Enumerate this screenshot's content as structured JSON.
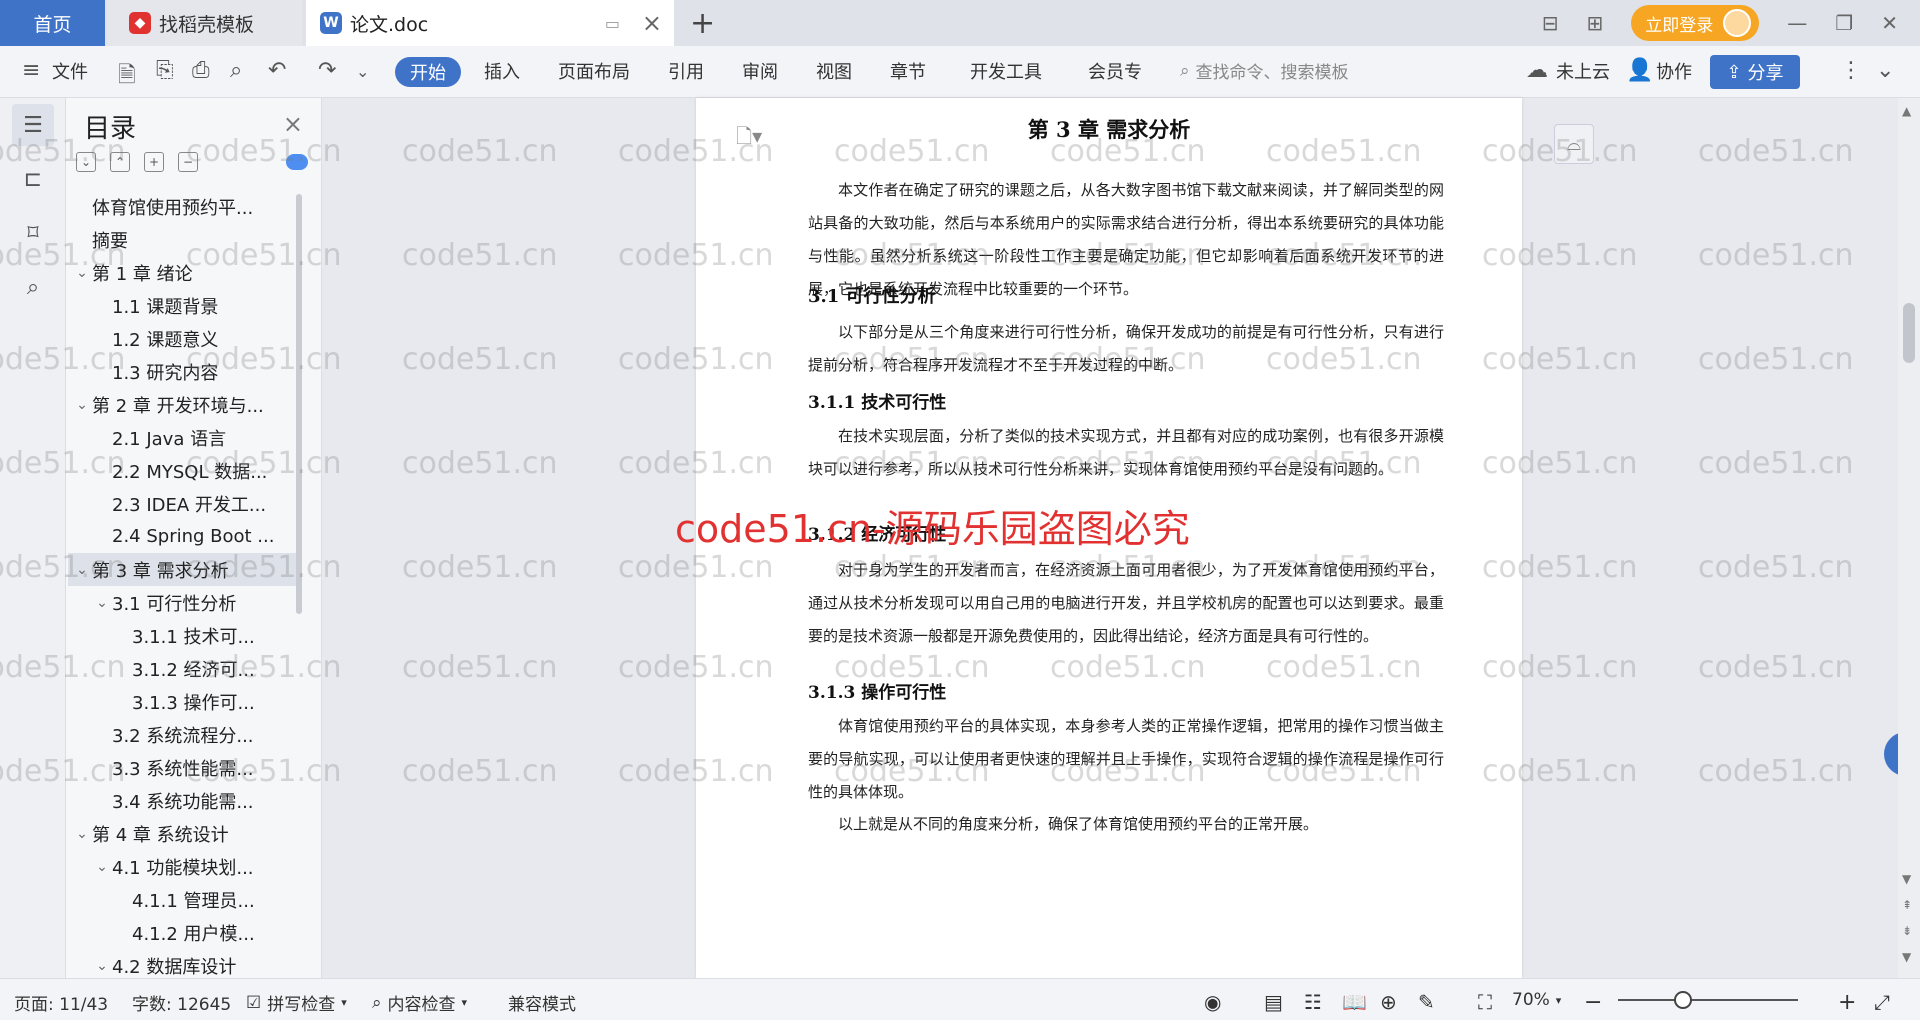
{
  "titlebar": {
    "tab_home": "首页",
    "tab_template": "找稻壳模板",
    "tab_doc": "论文.doc",
    "login": "立即登录"
  },
  "ribbon": {
    "file": "文件",
    "tabs": [
      "开始",
      "插入",
      "页面布局",
      "引用",
      "审阅",
      "视图",
      "章节",
      "开发工具",
      "会员专"
    ],
    "search_placeholder": "查找命令、搜索模板",
    "cloud": "未上云",
    "collab": "协作",
    "share": "分享"
  },
  "toc": {
    "title": "目录",
    "items": [
      {
        "label": "体育馆使用预约平...",
        "level": 0,
        "arrow": ""
      },
      {
        "label": "摘要",
        "level": 0,
        "arrow": ""
      },
      {
        "label": "第 1 章  绪论",
        "level": 0,
        "arrow": "⌄"
      },
      {
        "label": "1.1  课题背景",
        "level": 1,
        "arrow": ""
      },
      {
        "label": "1.2  课题意义",
        "level": 1,
        "arrow": ""
      },
      {
        "label": "1.3  研究内容",
        "level": 1,
        "arrow": ""
      },
      {
        "label": "第 2 章  开发环境与...",
        "level": 0,
        "arrow": "⌄"
      },
      {
        "label": "2.1 Java 语言",
        "level": 1,
        "arrow": ""
      },
      {
        "label": "2.2 MYSQL 数据...",
        "level": 1,
        "arrow": ""
      },
      {
        "label": "2.3 IDEA 开发工...",
        "level": 1,
        "arrow": ""
      },
      {
        "label": "2.4 Spring Boot ...",
        "level": 1,
        "arrow": ""
      },
      {
        "label": "第 3 章  需求分析",
        "level": 0,
        "arrow": "⌄",
        "selected": true
      },
      {
        "label": "3.1  可行性分析",
        "level": 1,
        "arrow": "⌄"
      },
      {
        "label": "3.1.1  技术可...",
        "level": 2,
        "arrow": ""
      },
      {
        "label": "3.1.2  经济可...",
        "level": 2,
        "arrow": ""
      },
      {
        "label": "3.1.3  操作可...",
        "level": 2,
        "arrow": ""
      },
      {
        "label": "3.2  系统流程分...",
        "level": 1,
        "arrow": ""
      },
      {
        "label": "3.3  系统性能需...",
        "level": 1,
        "arrow": ""
      },
      {
        "label": "3.4  系统功能需...",
        "level": 1,
        "arrow": ""
      },
      {
        "label": "第 4 章  系统设计",
        "level": 0,
        "arrow": "⌄"
      },
      {
        "label": "4.1  功能模块划...",
        "level": 1,
        "arrow": "⌄"
      },
      {
        "label": "4.1.1  管理员...",
        "level": 2,
        "arrow": ""
      },
      {
        "label": "4.1.2  用户模...",
        "level": 2,
        "arrow": ""
      },
      {
        "label": "4.2  数据库设计",
        "level": 1,
        "arrow": "⌄"
      }
    ]
  },
  "document": {
    "chapter_title": "第 3 章  需求分析",
    "intro": "本文作者在确定了研究的课题之后，从各大数字图书馆下载文献来阅读，并了解同类型的网站具备的大致功能，然后与本系统用户的实际需求结合进行分析，得出本系统要研究的具体功能与性能。虽然分析系统这一阶段性工作主要是确定功能，但它却影响着后面系统开发环节的进展，它也是系统开发流程中比较重要的一个环节。",
    "h_31": "3.1  可行性分析",
    "p_31": "以下部分是从三个角度来进行可行性分析，确保开发成功的前提是有可行性分析，只有进行提前分析，符合程序开发流程才不至于开发过程的中断。",
    "h_311": "3.1.1  技术可行性",
    "p_311": "在技术实现层面，分析了类似的技术实现方式，并且都有对应的成功案例，也有很多开源模块可以进行参考，所以从技术可行性分析来讲，实现体育馆使用预约平台是没有问题的。",
    "h_312": "3.1.2  经济可行性",
    "p_312": "对于身为学生的开发者而言，在经济资源上面可用者很少，为了开发体育馆使用预约平台，通过从技术分析发现可以用自己用的电脑进行开发，并且学校机房的配置也可以达到要求。最重要的是技术资源一般都是开源免费使用的，因此得出结论，经济方面是具有可行性的。",
    "h_313": "3.1.3  操作可行性",
    "p_313": "体育馆使用预约平台的具体实现，本身参考人类的正常操作逻辑，把常用的操作习惯当做主要的导航实现，可以让使用者更快速的理解并且上手操作，实现符合逻辑的操作流程是操作可行性的具体体现。",
    "p_last": "以上就是从不同的角度来分析，确保了体育馆使用预约平台的正常开展。"
  },
  "watermark": {
    "text": "code51.cn",
    "red_text": "code51.cn-源码乐园盗图必究"
  },
  "status": {
    "page": "页面: 11/43",
    "words": "字数: 12645",
    "spell": "拼写检查",
    "content": "内容检查",
    "compat": "兼容模式",
    "zoom": "70%"
  },
  "colors": {
    "accent": "#3f73c8",
    "login": "#f6a623",
    "watermark_red": "#e23131"
  }
}
